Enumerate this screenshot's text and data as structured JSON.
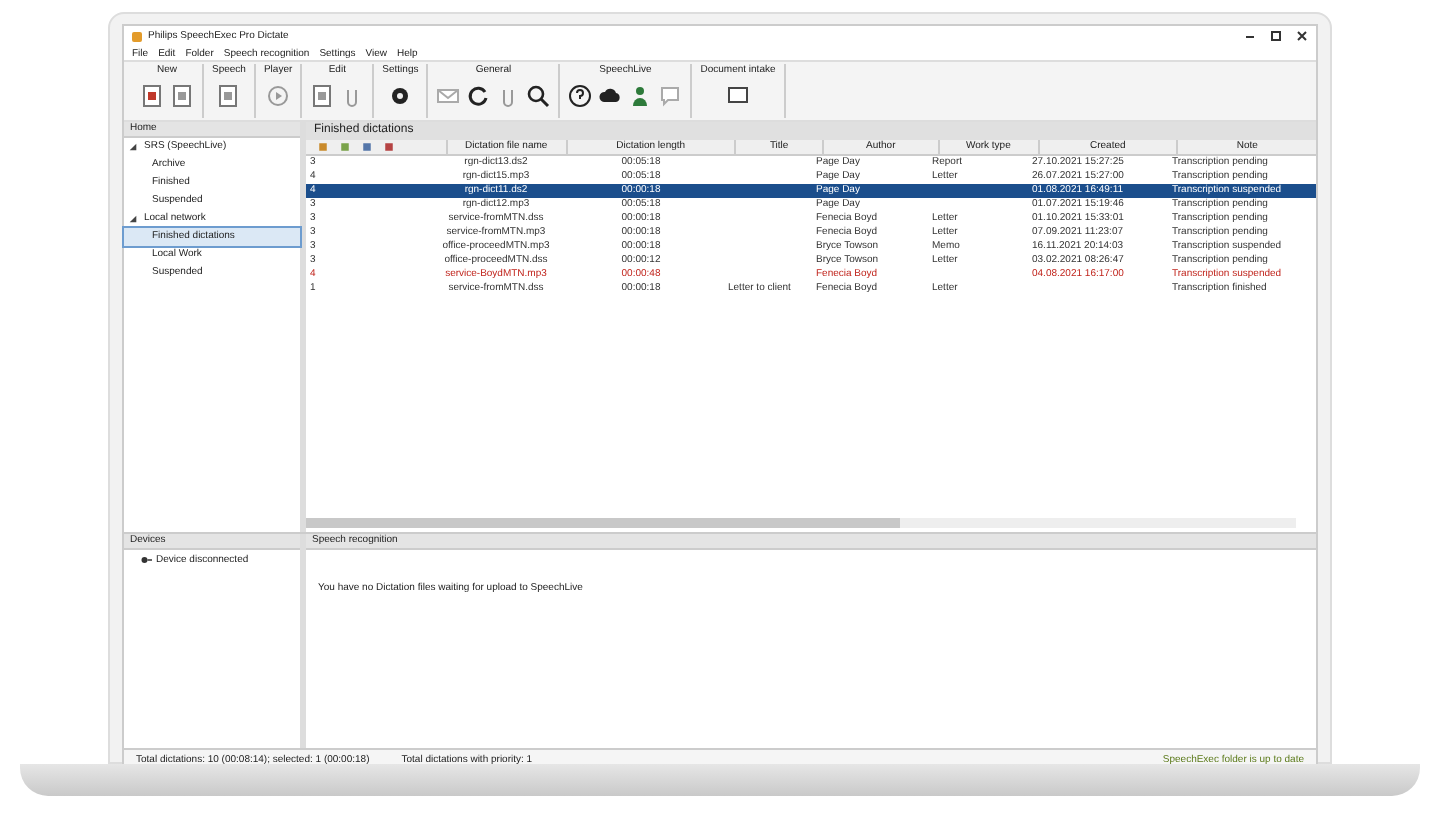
{
  "window": {
    "title": "Philips SpeechExec Pro Dictate"
  },
  "menu": [
    "File",
    "Edit",
    "Folder",
    "Speech recognition",
    "Settings",
    "View",
    "Help"
  ],
  "toolbar_groups": [
    {
      "label": "New"
    },
    {
      "label": "Speech"
    },
    {
      "label": "Player"
    },
    {
      "label": "Edit"
    },
    {
      "label": "Settings"
    },
    {
      "label": "General"
    },
    {
      "label": "SpeechLive"
    },
    {
      "label": "Document intake"
    }
  ],
  "sidebar": {
    "title": "Home",
    "items": [
      {
        "label": "SRS (SpeechLive)",
        "expanded": true,
        "selected": false,
        "children": [
          {
            "label": "Archive",
            "selected": false
          },
          {
            "label": "Finished",
            "selected": false
          },
          {
            "label": "Suspended",
            "selected": false
          }
        ]
      },
      {
        "label": "Local network",
        "expanded": true,
        "selected": false,
        "children": [
          {
            "label": "Finished dictations",
            "selected": true
          },
          {
            "label": "Local Work",
            "selected": false
          },
          {
            "label": "Suspended",
            "selected": false
          }
        ]
      }
    ]
  },
  "table": {
    "title": "Finished dictations",
    "columns": [
      "",
      "Dictation file name",
      "Dictation length",
      "Title",
      "Author",
      "Work type",
      "Created",
      "Note"
    ],
    "rows": [
      {
        "cells": [
          "3",
          "rgn-dict13.ds2",
          "00:05:18",
          "",
          "Page Day",
          "Report",
          "27.10.2021 15:27:25",
          "Transcription pending"
        ],
        "selected": false,
        "priority": false
      },
      {
        "cells": [
          "4",
          "rgn-dict15.mp3",
          "00:05:18",
          "",
          "Page Day",
          "Letter",
          "26.07.2021 15:27:00",
          "Transcription pending"
        ],
        "selected": false,
        "priority": false
      },
      {
        "cells": [
          "4",
          "rgn-dict11.ds2",
          "00:00:18",
          "",
          "Page Day",
          "",
          "01.08.2021 16:49:11",
          "Transcription suspended"
        ],
        "selected": true,
        "priority": false
      },
      {
        "cells": [
          "3",
          "rgn-dict12.mp3",
          "00:05:18",
          "",
          "Page Day",
          "",
          "01.07.2021 15:19:46",
          "Transcription pending"
        ],
        "selected": false,
        "priority": false
      },
      {
        "cells": [
          "3",
          "service-fromMTN.dss",
          "00:00:18",
          "",
          "Fenecia Boyd",
          "Letter",
          "01.10.2021 15:33:01",
          "Transcription pending"
        ],
        "selected": false,
        "priority": false
      },
      {
        "cells": [
          "3",
          "service-fromMTN.mp3",
          "00:00:18",
          "",
          "Fenecia Boyd",
          "Letter",
          "07.09.2021 11:23:07",
          "Transcription pending"
        ],
        "selected": false,
        "priority": false
      },
      {
        "cells": [
          "3",
          "office-proceedMTN.mp3",
          "00:00:18",
          "",
          "Bryce Towson",
          "Memo",
          "16.11.2021 20:14:03",
          "Transcription suspended"
        ],
        "selected": false,
        "priority": false
      },
      {
        "cells": [
          "3",
          "office-proceedMTN.dss",
          "00:00:12",
          "",
          "Bryce Towson",
          "Letter",
          "03.02.2021 08:26:47",
          "Transcription pending"
        ],
        "selected": false,
        "priority": false
      },
      {
        "cells": [
          "4",
          "service-BoydMTN.mp3",
          "00:00:48",
          "",
          "Fenecia Boyd",
          "",
          "04.08.2021 16:17:00",
          "Transcription suspended"
        ],
        "selected": false,
        "priority": true
      },
      {
        "cells": [
          "1",
          "service-fromMTN.dss",
          "00:00:18",
          "Letter to client",
          "Fenecia Boyd",
          "Letter",
          "",
          "Transcription finished"
        ],
        "selected": false,
        "priority": false
      }
    ]
  },
  "devices": {
    "title": "Devices",
    "items": [
      "Device disconnected"
    ]
  },
  "speech_panel": {
    "title": "Speech recognition",
    "message": "You have no Dictation files waiting for upload to SpeechLive"
  },
  "status_bar": {
    "left": "Total dictations: 10 (00:08:14); selected: 1 (00:00:18)",
    "middle": "Total dictations with priority: 1",
    "right": "SpeechExec folder is up to date"
  }
}
